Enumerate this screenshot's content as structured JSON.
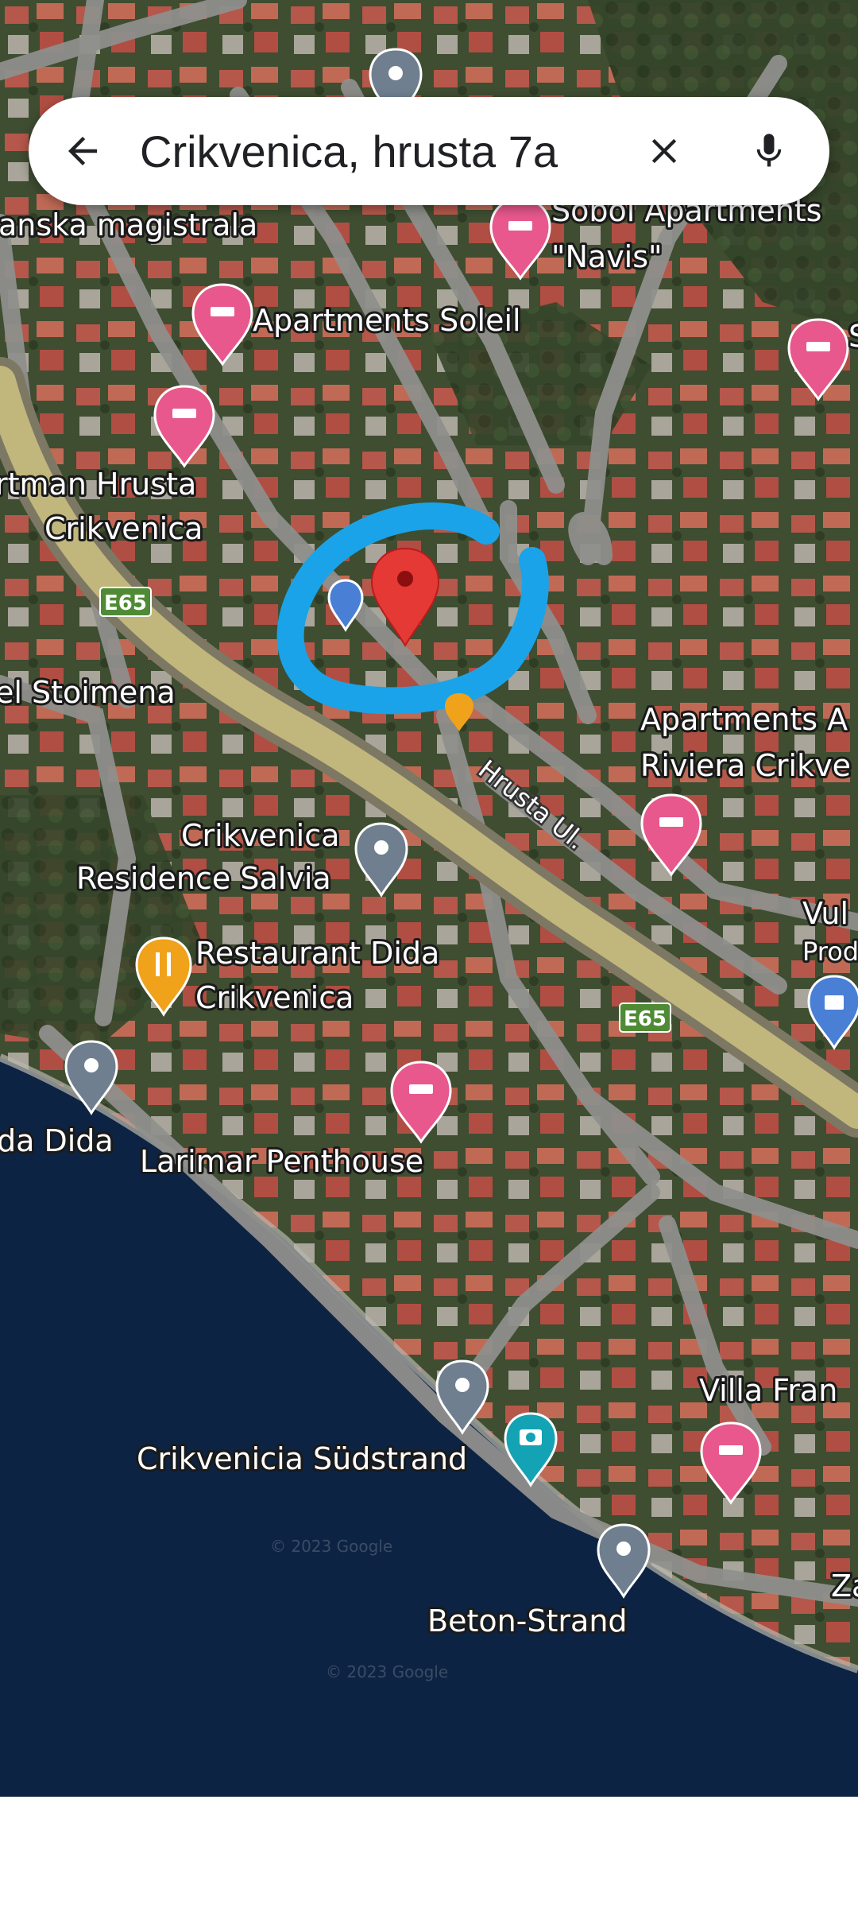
{
  "search": {
    "query": "Crikvenica, hrusta 7a",
    "back_icon": "arrow-left-icon",
    "clear_icon": "close-icon",
    "mic_icon": "microphone-icon"
  },
  "map": {
    "colors": {
      "sea": "#0d2343",
      "land": "#4a5a3a",
      "road": "#9a9a96",
      "highway": "#c9bd7e",
      "highlight": "#1aa3e8",
      "pin_red": "#e53935",
      "hotel_pin": "#e8588c",
      "gray_pin": "#6f7f8f",
      "food_pin": "#f0a21a",
      "shield": "#4f8b35"
    },
    "labels": {
      "magistrala": "anska magistrala",
      "sobol_1": "Sobol Apartments",
      "sobol_2": "\"Navis\"",
      "soleil": "Apartments Soleil",
      "hrusta_1": "rtman Hrusta",
      "hrusta_2": "Crikvenica",
      "stoimena": "el Stoimena",
      "apartments_a": "Apartments A",
      "riviera": "Riviera Crikve",
      "hrusta_ul": "Hrusta Ul.",
      "salvia_1": "Crikvenica",
      "salvia_2": "Residence Salvia",
      "vul_1": "Vul",
      "vul_2": "Prod",
      "dida_1": "Restaurant Dida",
      "dida_2": "Crikvenica",
      "da_dida": "da Dida",
      "larimar": "Larimar Penthouse",
      "villa": "Villa Fran",
      "sudstrand": "Crikvenicia Südstrand",
      "beton": "Beton-Strand",
      "za": "Za",
      "s_edge": "S",
      "e65_1": "E65",
      "e65_2": "E65"
    },
    "watermarks": [
      "© 2023 Google",
      "© 2023 Google"
    ]
  }
}
